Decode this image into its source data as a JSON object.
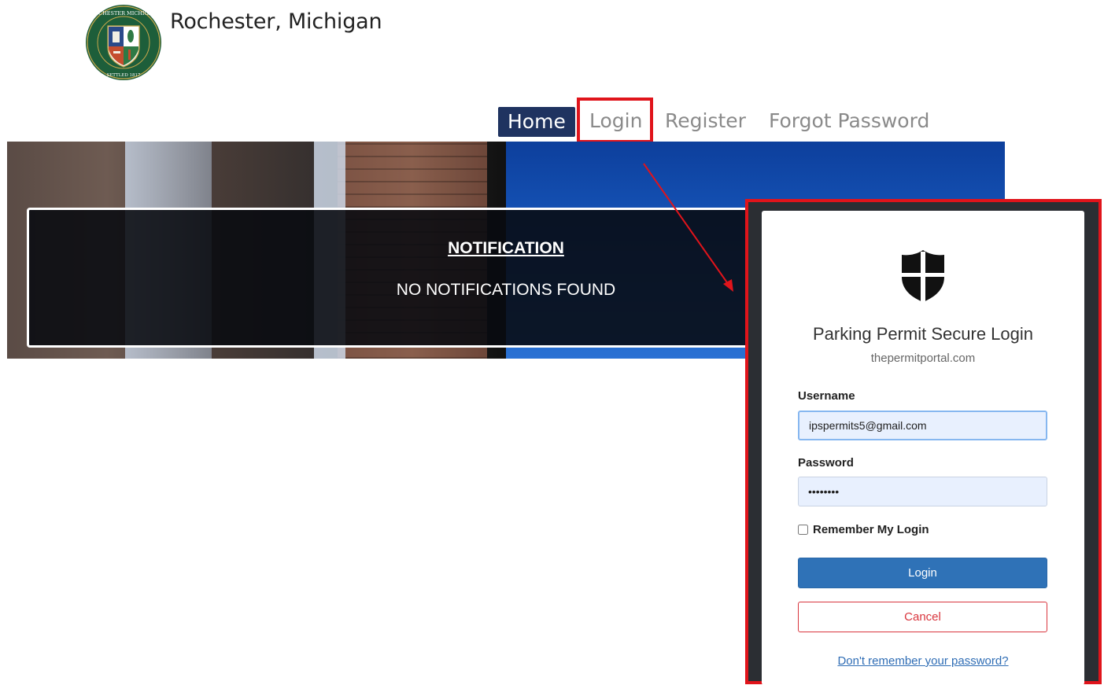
{
  "header": {
    "site_title": "Rochester, Michigan",
    "logo_seal_text": "ROCHESTER MICHIGAN · SETTLED 1817"
  },
  "nav": {
    "home": "Home",
    "login": "Login",
    "register": "Register",
    "forgot": "Forgot Password",
    "active": "Home"
  },
  "notification": {
    "title": "NOTIFICATION",
    "message": "NO NOTIFICATIONS FOUND"
  },
  "login_modal": {
    "icon": "shield-icon",
    "title": "Parking Permit Secure Login",
    "subtitle": "thepermitportal.com",
    "username_label": "Username",
    "username_value": "ipspermits5@gmail.com",
    "password_label": "Password",
    "password_value": "••••••••",
    "remember_label": "Remember My Login",
    "remember_checked": false,
    "login_button": "Login",
    "cancel_button": "Cancel",
    "forgot_link": "Don't remember your password?"
  },
  "colors": {
    "nav_active_bg": "#1f3360",
    "highlight_red": "#e0141b",
    "login_button": "#2f72b7",
    "cancel_red": "#d9363e",
    "link_blue": "#2f6db5"
  }
}
